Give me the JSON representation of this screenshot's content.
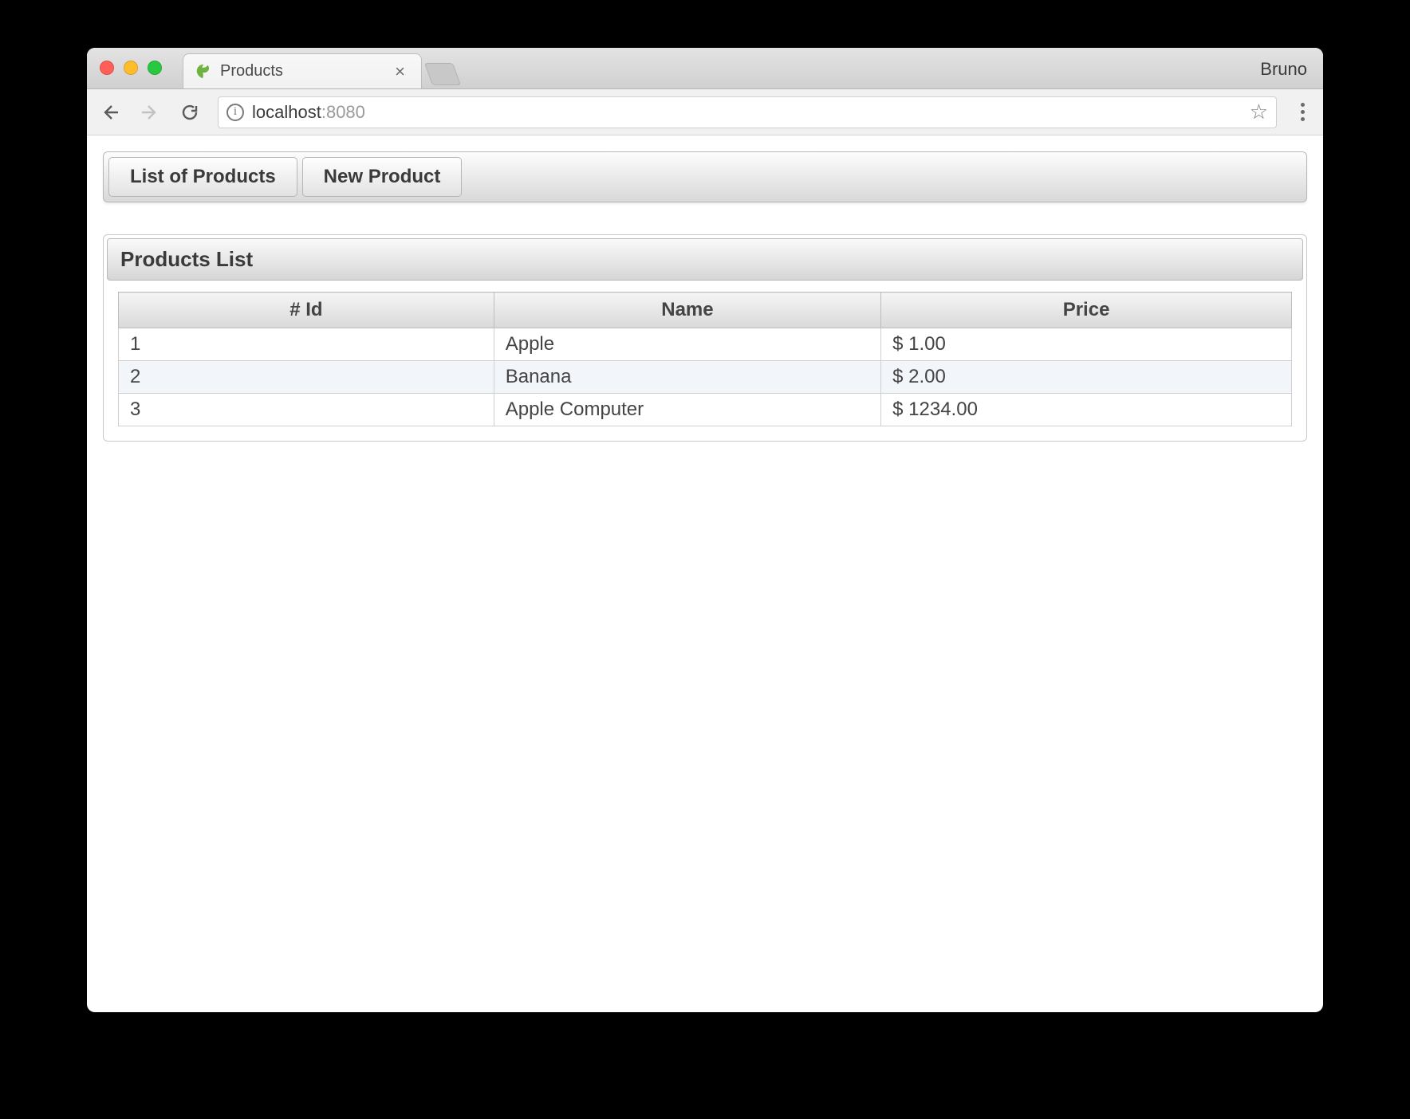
{
  "browser": {
    "profile_name": "Bruno",
    "tab": {
      "title": "Products"
    },
    "url_host": "localhost",
    "url_port": ":8080"
  },
  "menubar": {
    "list_label": "List of Products",
    "new_label": "New Product"
  },
  "panel": {
    "title": "Products List"
  },
  "table": {
    "headers": {
      "id": "# Id",
      "name": "Name",
      "price": "Price"
    },
    "rows": [
      {
        "id": "1",
        "name": "Apple",
        "price": "$ 1.00"
      },
      {
        "id": "2",
        "name": "Banana",
        "price": "$ 2.00"
      },
      {
        "id": "3",
        "name": "Apple Computer",
        "price": "$ 1234.00"
      }
    ]
  }
}
